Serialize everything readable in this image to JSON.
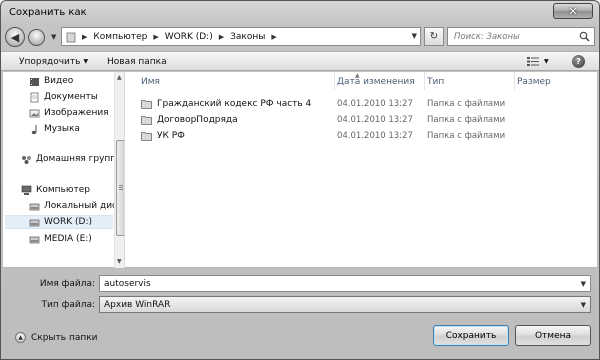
{
  "window": {
    "title": "Сохранить как"
  },
  "address_bar": {
    "crumbs": [
      "Компьютер",
      "WORK (D:)",
      "Законы"
    ],
    "search_placeholder": "Поиск: Законы"
  },
  "toolbar": {
    "organize_label": "Упорядочить",
    "new_folder_label": "Новая папка"
  },
  "nav_pane": {
    "items": [
      {
        "label": "Видео",
        "icon": "video-library-icon"
      },
      {
        "label": "Документы",
        "icon": "documents-library-icon"
      },
      {
        "label": "Изображения",
        "icon": "pictures-library-icon"
      },
      {
        "label": "Музыка",
        "icon": "music-library-icon"
      },
      {
        "label": "Домашняя группа",
        "icon": "homegroup-icon"
      },
      {
        "label": "Компьютер",
        "icon": "computer-icon"
      },
      {
        "label": "Локальный диск",
        "icon": "drive-icon"
      },
      {
        "label": "WORK (D:)",
        "icon": "drive-icon",
        "selected": true
      },
      {
        "label": "MEDIA (E:)",
        "icon": "drive-icon"
      }
    ]
  },
  "file_list": {
    "columns": [
      "Имя",
      "Дата изменения",
      "Тип",
      "Размер"
    ],
    "rows": [
      {
        "name": "Гражданский кодекс РФ часть 4",
        "date": "04.01.2010 13:27",
        "type": "Папка с файлами"
      },
      {
        "name": "ДоговорПодряда",
        "date": "04.01.2010 13:27",
        "type": "Папка с файлами"
      },
      {
        "name": "УК РФ",
        "date": "04.01.2010 13:27",
        "type": "Папка с файлами"
      }
    ]
  },
  "form": {
    "filename_label": "Имя файла:",
    "filename_value": "autoservis",
    "filetype_label": "Тип файла:",
    "filetype_value": "Архив WinRAR"
  },
  "footer": {
    "hide_folders_label": "Скрыть папки",
    "save_label": "Сохранить",
    "cancel_label": "Отмена"
  }
}
